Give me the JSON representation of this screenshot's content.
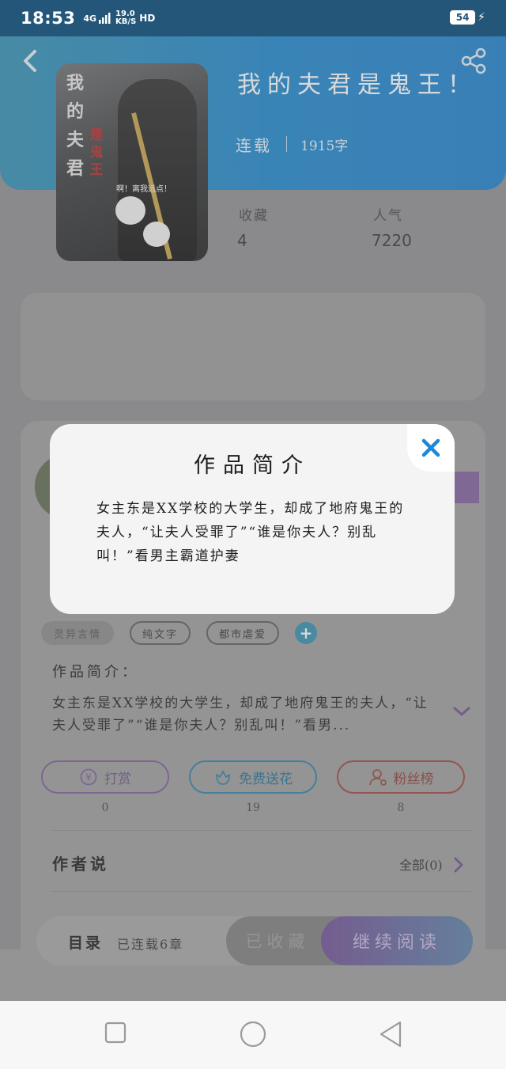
{
  "status_bar": {
    "time": "18:53",
    "network": "4G",
    "speed_value": "19.0",
    "speed_unit": "KB/S",
    "hd": "HD",
    "battery": "54"
  },
  "book": {
    "title": "我的夫君是鬼王！",
    "status": "连载",
    "word_count": "1915字",
    "cover_title": "我的夫君",
    "cover_subtitle": "是鬼王",
    "cover_bubble": "啊！离我远点！"
  },
  "stats": [
    {
      "label": "收藏",
      "value": "4"
    },
    {
      "label": "人气",
      "value": "7220"
    }
  ],
  "tags": [
    "灵异言情",
    "纯文字",
    "都市虐爱"
  ],
  "intro": {
    "heading": "作品简介：",
    "text": "女主东是XX学校的大学生，却成了地府鬼王的夫人，“让夫人受罪了”“谁是你夫人？别乱叫！”看男..."
  },
  "actions": [
    {
      "label": "打赏",
      "count": "0",
      "icon": "yen-icon"
    },
    {
      "label": "免费送花",
      "count": "19",
      "icon": "flower-icon"
    },
    {
      "label": "粉丝榜",
      "count": "8",
      "icon": "user-icon"
    }
  ],
  "author_say": {
    "label": "作者说",
    "all": "全部(0)"
  },
  "bottom_bar": {
    "toc": "目录",
    "progress": "已连载6章",
    "collected": "已收藏",
    "continue": "继续阅读"
  },
  "modal": {
    "title": "作品简介",
    "body": "女主东是XX学校的大学生，却成了地府鬼王的夫人，“让夫人受罪了”“谁是你夫人？别乱叫！”看男主霸道护妻"
  },
  "colors": {
    "header_blue": "#1a86cf",
    "close_blue": "#1e88d8",
    "reward_purple": "#7c5c98",
    "flower_blue": "#2a80a6",
    "fans_red": "#9c433c"
  }
}
